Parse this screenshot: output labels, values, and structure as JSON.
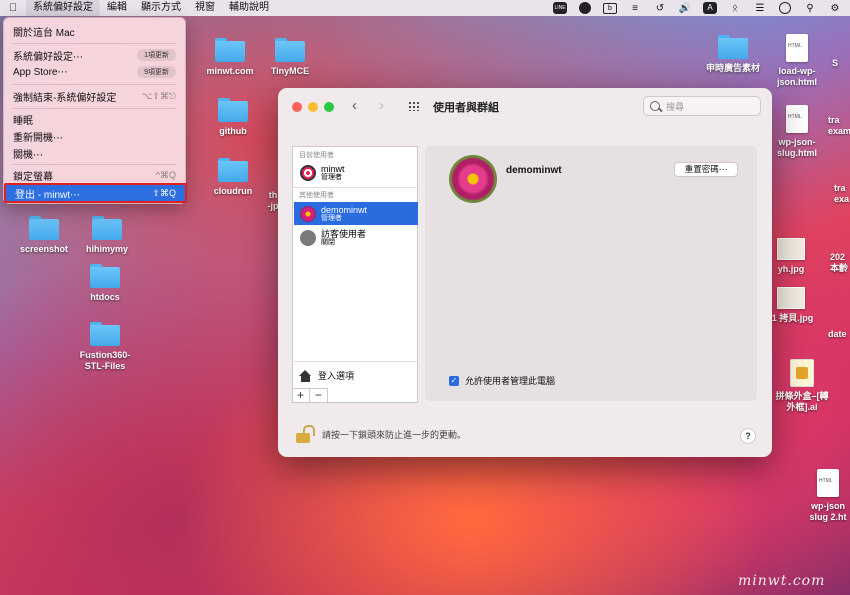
{
  "menubar": {
    "apple": "",
    "items": [
      "系統偏好設定",
      "編輯",
      "顯示方式",
      "視窗",
      "輔助說明"
    ],
    "status": {
      "line": "LINE",
      "input_a": "A"
    }
  },
  "apple_menu": {
    "items": [
      {
        "label": "關於這台 Mac",
        "badge": "",
        "shortcut": ""
      },
      {
        "label": "系統偏好設定⋯",
        "badge": "1項更新",
        "shortcut": ""
      },
      {
        "label": "App Store⋯",
        "badge": "9項更新",
        "shortcut": ""
      },
      {
        "label": "強制結束-系統偏好設定",
        "badge": "",
        "shortcut": "⌥⇧⌘⎋"
      },
      {
        "label": "睡眠",
        "badge": "",
        "shortcut": ""
      },
      {
        "label": "重新開機⋯",
        "badge": "",
        "shortcut": ""
      },
      {
        "label": "關機⋯",
        "badge": "",
        "shortcut": ""
      },
      {
        "label": "鎖定螢幕",
        "badge": "",
        "shortcut": "^⌘Q"
      },
      {
        "label": "登出 - minwt⋯",
        "badge": "",
        "shortcut": "⇧⌘Q"
      }
    ]
  },
  "desktop": {
    "icons": [
      {
        "label": "minwt.com"
      },
      {
        "label": "TinyMCE"
      },
      {
        "label": "github"
      },
      {
        "label": "cloudrun"
      },
      {
        "label": "screenshot"
      },
      {
        "label": "hihimymy"
      },
      {
        "label": "htdocs"
      },
      {
        "label": "Fustion360-\nSTL-Files"
      },
      {
        "label": "申時廣告素材"
      },
      {
        "label": "load-wp-\njson.html"
      },
      {
        "label": "wp-json-\nslug.html"
      },
      {
        "label": "yh.jpg"
      },
      {
        "label": "-1 拷貝.jpg"
      },
      {
        "label": "拼條外盒–[轉\n外框].ai"
      },
      {
        "label": "wp-json\nslug 2.ht"
      },
      {
        "label": "th\n-jp"
      },
      {
        "label": "S"
      },
      {
        "label": "tra\nexam"
      },
      {
        "label": "tra\nexa"
      },
      {
        "label": "202\n本齡"
      },
      {
        "label": "date"
      }
    ]
  },
  "window": {
    "title": "使用者與群組",
    "search_placeholder": "搜尋",
    "list": {
      "current_header": "目前使用者",
      "other_header": "其他使用者",
      "users": [
        {
          "name": "minwt",
          "role": "管理者"
        },
        {
          "name": "demominwt",
          "role": "管理者"
        },
        {
          "name": "訪客使用者",
          "role": "關閉"
        }
      ],
      "login_options": "登入選項",
      "add": "+",
      "remove": "−"
    },
    "detail": {
      "username": "demominwt",
      "reset_password": "重置密碼⋯",
      "allow_admin": "允許使用者管理此電腦",
      "checked": "✓"
    },
    "lock_text": "請按一下鎖頭來防止進一步的更動。",
    "help": "?"
  },
  "watermark": "minwt.com",
  "colors": {
    "selection_blue": "#2a6be0",
    "highlight_border": "#e02020"
  }
}
